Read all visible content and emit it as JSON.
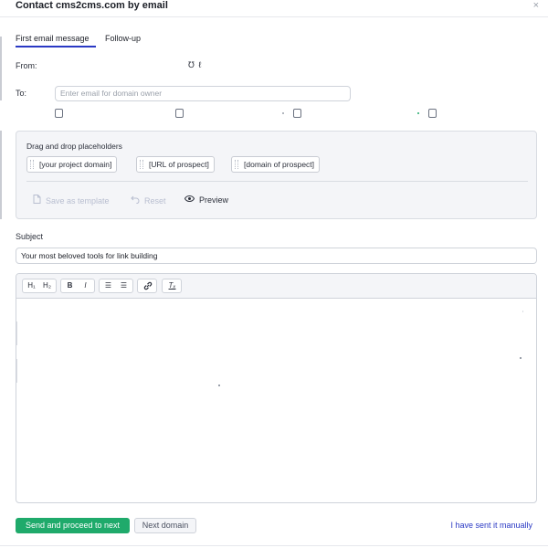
{
  "dialog": {
    "title": "Contact cms2cms.com by email",
    "close_glyph": "×"
  },
  "tabs": [
    {
      "label": "First email message",
      "active": true
    },
    {
      "label": "Follow-up",
      "active": false
    }
  ],
  "from": {
    "label": "From:",
    "value": "℧ ℓ"
  },
  "to": {
    "label": "To:",
    "placeholder": "Enter email for domain owner"
  },
  "placeholders": {
    "title": "Drag and drop placeholders",
    "chips": [
      "[your project domain]",
      "[URL of prospect]",
      "[domain of prospect]"
    ]
  },
  "actions": {
    "save_template": "Save as template",
    "reset": "Reset",
    "preview": "Preview",
    "icons": {
      "save": "document-icon",
      "reset": "undo-icon",
      "preview": "eye-icon"
    }
  },
  "subject": {
    "label": "Subject",
    "value": "Your most beloved tools for link building"
  },
  "editor": {
    "toolbar": {
      "h1": "H₁",
      "h2": "H₂",
      "bold": "B",
      "italic": "I",
      "ordered_list": "☰",
      "bullet_list": "☰",
      "link": "🔗",
      "clear_format": "Tₓ"
    }
  },
  "footer": {
    "send_button": "Send and proceed to next",
    "next_button": "Next domain",
    "manual_link": "I have sent it manually"
  },
  "colors": {
    "accent": "#2a39c4",
    "send_green": "#1faa6b",
    "panel_bg": "#f4f5f8",
    "border": "#cfd3da"
  }
}
